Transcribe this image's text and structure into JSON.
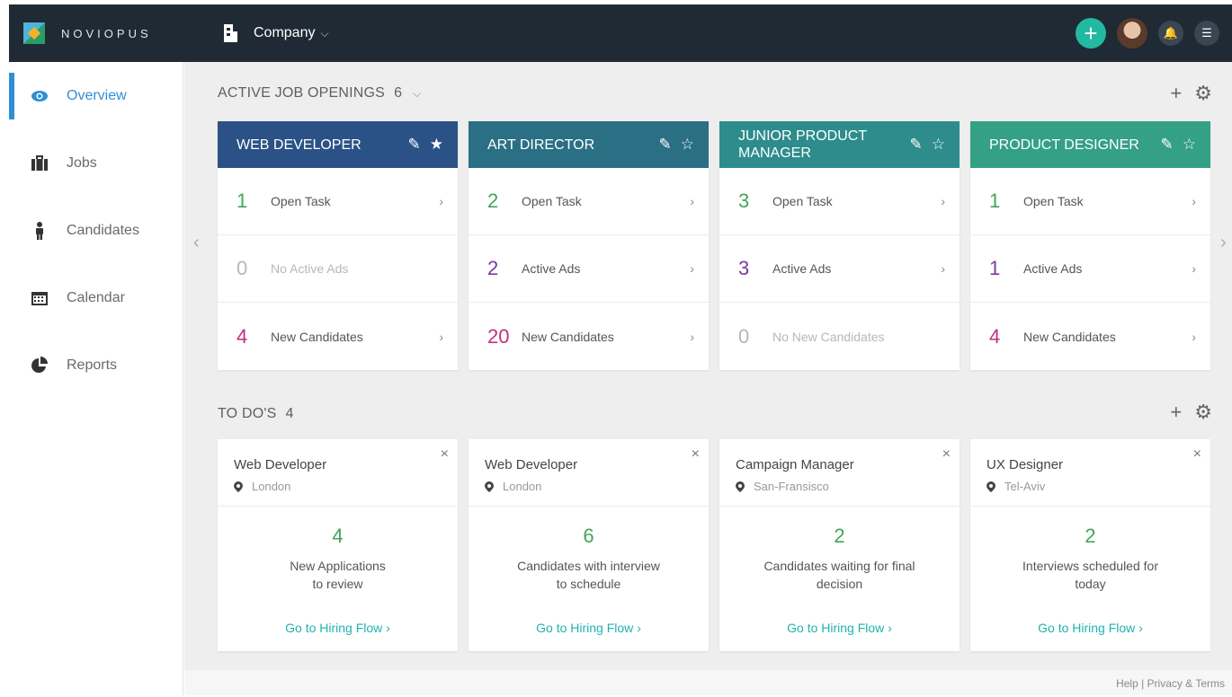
{
  "brand": {
    "name": "NOVIOPUS"
  },
  "company": {
    "label": "Company",
    "chevron": "chevron-down-icon"
  },
  "sidebar": {
    "items": [
      {
        "label": "Overview",
        "icon": "eye-icon",
        "active": true
      },
      {
        "label": "Jobs",
        "icon": "briefcase-icon"
      },
      {
        "label": "Candidates",
        "icon": "person-icon"
      },
      {
        "label": "Calendar",
        "icon": "calendar-icon"
      },
      {
        "label": "Reports",
        "icon": "pie-chart-icon"
      }
    ]
  },
  "jobs_section": {
    "title": "ACTIVE JOB OPENINGS",
    "count": "6"
  },
  "jobs": [
    {
      "title": "WEB DEVELOPER",
      "color": "#2b5286",
      "starred": true,
      "rows": [
        {
          "num": "1",
          "label": "Open Task",
          "color": "#43a55a"
        },
        {
          "num": "0",
          "label": "No Active Ads",
          "dim": true
        },
        {
          "num": "4",
          "label": "New Candidates",
          "color": "#c2307a"
        }
      ]
    },
    {
      "title": "ART DIRECTOR",
      "color": "#2b6f84",
      "starred": false,
      "rows": [
        {
          "num": "2",
          "label": "Open Task",
          "color": "#43a55a"
        },
        {
          "num": "2",
          "label": "Active Ads",
          "color": "#7b3aa0"
        },
        {
          "num": "20",
          "label": "New Candidates",
          "color": "#c2307a"
        }
      ]
    },
    {
      "title": "JUNIOR PRODUCT MANAGER",
      "color": "#2e8c8c",
      "starred": false,
      "rows": [
        {
          "num": "3",
          "label": "Open Task",
          "color": "#43a55a"
        },
        {
          "num": "3",
          "label": "Active Ads",
          "color": "#7b3aa0"
        },
        {
          "num": "0",
          "label": "No New Candidates",
          "dim": true
        }
      ]
    },
    {
      "title": "PRODUCT DESIGNER",
      "color": "#34a086",
      "starred": false,
      "rows": [
        {
          "num": "1",
          "label": "Open Task",
          "color": "#43a55a"
        },
        {
          "num": "1",
          "label": "Active Ads",
          "color": "#7b3aa0"
        },
        {
          "num": "4",
          "label": "New Candidates",
          "color": "#c2307a"
        }
      ]
    }
  ],
  "todo_section": {
    "title": "TO DO'S",
    "count": "4"
  },
  "todos": [
    {
      "title": "Web Developer",
      "location": "London",
      "num": "4",
      "text_line1": "New Applications",
      "text_line2": "to review",
      "link": "Go to Hiring Flow"
    },
    {
      "title": "Web Developer",
      "location": "London",
      "num": "6",
      "text_line1": "Candidates with interview",
      "text_line2": "to schedule",
      "link": "Go to Hiring Flow"
    },
    {
      "title": "Campaign Manager",
      "location": "San-Fransisco",
      "num": "2",
      "text_line1": "Candidates waiting for final",
      "text_line2": "decision",
      "link": "Go to Hiring Flow"
    },
    {
      "title": "UX Designer",
      "location": "Tel-Aviv",
      "num": "2",
      "text_line1": "Interviews scheduled for",
      "text_line2": "today",
      "link": "Go to Hiring Flow"
    }
  ],
  "footer": {
    "text": "Help | Privacy & Terms"
  },
  "colors": {
    "accent": "#2f8fd6",
    "teal": "#22b9a3",
    "link": "#1fb3b0"
  }
}
